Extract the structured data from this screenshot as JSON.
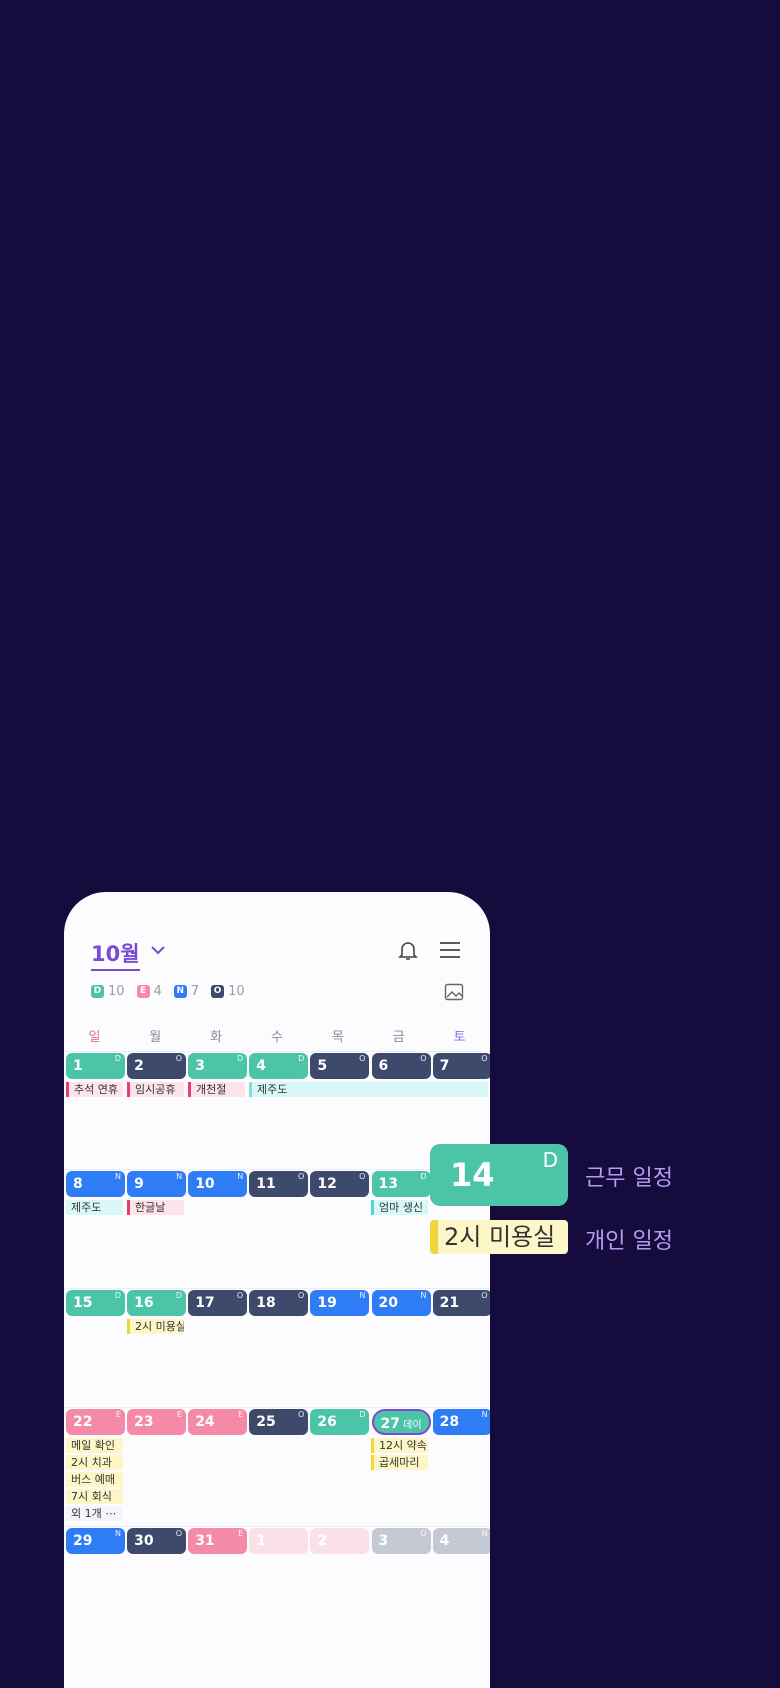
{
  "header": {
    "month": "10월"
  },
  "counts": [
    {
      "code": "D",
      "value": "10",
      "color": "#4cc4a8"
    },
    {
      "code": "E",
      "value": "4",
      "color": "#f48aa8"
    },
    {
      "code": "N",
      "value": "7",
      "color": "#2f7df6"
    },
    {
      "code": "O",
      "value": "10",
      "color": "#3d4a6b"
    }
  ],
  "weekdays": [
    "일",
    "월",
    "화",
    "수",
    "목",
    "금",
    "토"
  ],
  "weeks": [
    {
      "days": [
        [
          "1",
          "D"
        ],
        [
          "2",
          "O"
        ],
        [
          "3",
          "D"
        ],
        [
          "4",
          "D"
        ],
        [
          "5",
          "O"
        ],
        [
          "6",
          "O"
        ],
        [
          "7",
          "O"
        ]
      ]
    },
    {
      "days": [
        [
          "8",
          "N"
        ],
        [
          "9",
          "N"
        ],
        [
          "10",
          "N"
        ],
        [
          "11",
          "O"
        ],
        [
          "12",
          "O"
        ],
        [
          "13",
          "D"
        ],
        [
          "14",
          "D"
        ]
      ]
    },
    {
      "days": [
        [
          "15",
          "D"
        ],
        [
          "16",
          "D"
        ],
        [
          "17",
          "O"
        ],
        [
          "18",
          "O"
        ],
        [
          "19",
          "N"
        ],
        [
          "20",
          "N"
        ],
        [
          "21",
          "O"
        ]
      ]
    },
    {
      "days": [
        [
          "22",
          "E"
        ],
        [
          "23",
          "E"
        ],
        [
          "24",
          "E"
        ],
        [
          "25",
          "O"
        ],
        [
          "26",
          "D"
        ],
        [
          "27",
          "데이"
        ],
        [
          "28",
          "N"
        ]
      ]
    },
    {
      "days": [
        [
          "29",
          "N"
        ],
        [
          "30",
          "O"
        ],
        [
          "31",
          "E"
        ],
        [
          "1",
          ""
        ],
        [
          "2",
          ""
        ],
        [
          "3",
          "O"
        ],
        [
          "4",
          "N"
        ]
      ]
    }
  ],
  "events": {
    "w1": [
      "추석 연휴",
      "임시공휴",
      "개천절",
      "제주도"
    ],
    "w2": [
      "제주도",
      "한글날",
      "엄마 생신"
    ],
    "w3": [
      "2시 미용실"
    ],
    "w4": [
      "메일 확인",
      "2시 치과",
      "버스 예매",
      "7시 회식",
      "외 1개",
      "12시 약속",
      "곱세마리"
    ]
  },
  "legend": {
    "chip_day": "14",
    "chip_shift": "D",
    "chip_label": "근무 일정",
    "event_text": "2시 미용실",
    "event_label": "개인 일정"
  }
}
